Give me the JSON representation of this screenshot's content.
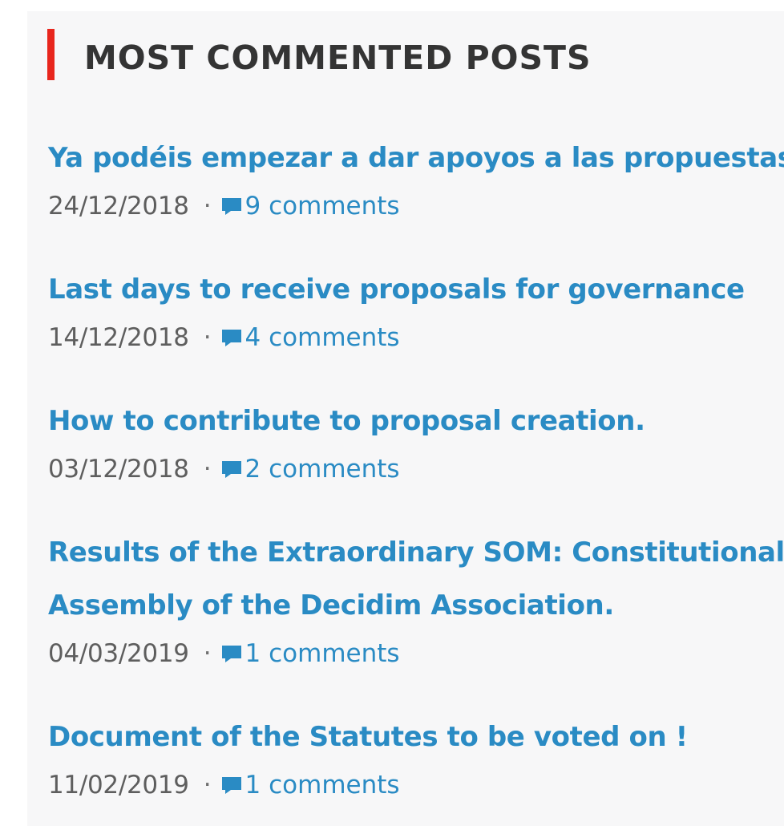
{
  "widget": {
    "title": "MOST COMMENTED POSTS",
    "accent_color": "#e8261d",
    "link_color": "#2a8bc4"
  },
  "posts": [
    {
      "title": "Ya podéis empezar a dar apoyos a las propuestas",
      "date": "24/12/2018",
      "separator": "·",
      "comments": "9 comments",
      "comment_icon": "comment-icon"
    },
    {
      "title": "Last days to receive proposals for governance",
      "date": "14/12/2018",
      "separator": "·",
      "comments": "4 comments",
      "comment_icon": "comment-icon"
    },
    {
      "title": "How to contribute to proposal creation.",
      "date": "03/12/2018",
      "separator": "·",
      "comments": "2 comments",
      "comment_icon": "comment-icon"
    },
    {
      "title_lines": [
        "Results of the Extraordinary SOM: Constitutional",
        "Assembly of the Decidim Association."
      ],
      "date": "04/03/2019",
      "separator": "·",
      "comments": "1 comments",
      "comment_icon": "comment-icon"
    },
    {
      "title": "Document of the Statutes to be voted on !",
      "date": "11/02/2019",
      "separator": "·",
      "comments": "1 comments",
      "comment_icon": "comment-icon"
    }
  ]
}
